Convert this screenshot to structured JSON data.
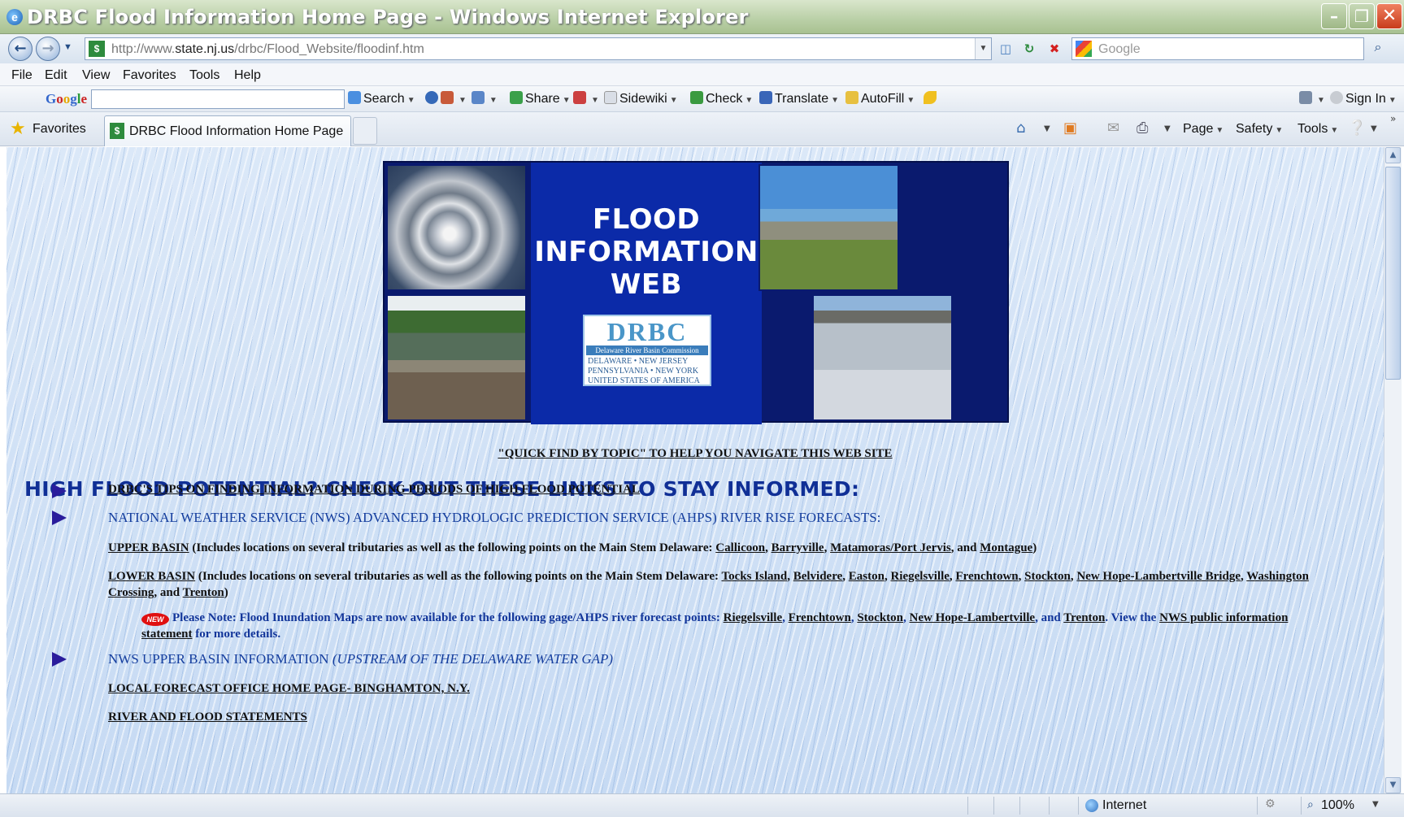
{
  "window": {
    "title": "DRBC Flood Information Home Page - Windows Internet Explorer",
    "controls": {
      "minimize": "–",
      "maximize": "❐",
      "close": "✕"
    }
  },
  "addressbar": {
    "url_prefix": "http://www.",
    "url_domain": "state.nj.us",
    "url_path": "/drbc/Flood_Website/floodinf.htm",
    "search_placeholder": "Google"
  },
  "menu": {
    "items": [
      "File",
      "Edit",
      "View",
      "Favorites",
      "Tools",
      "Help"
    ]
  },
  "google_toolbar": {
    "search": "Search",
    "share": "Share",
    "sidewiki": "Sidewiki",
    "check": "Check",
    "translate": "Translate",
    "autofill": "AutoFill",
    "sign_in": "Sign In"
  },
  "favorites_bar": {
    "favorites_label": "Favorites",
    "tab_title": "DRBC Flood Information Home Page",
    "commands": {
      "page": "Page",
      "safety": "Safety",
      "tools": "Tools"
    }
  },
  "banner": {
    "title_lines": [
      "FLOOD",
      "INFORMATION",
      "WEB"
    ],
    "logo_mark": "DRBC",
    "logo_name": "Delaware River Basin Commission",
    "logo_states": [
      "DELAWARE",
      "NEW JERSEY",
      "PENNSYLVANIA",
      "NEW YORK",
      "UNITED STATES OF AMERICA"
    ]
  },
  "content": {
    "quick_find": "\"QUICK FIND BY TOPIC\" TO HELP YOU NAVIGATE THIS WEB SITE",
    "headline": "HIGH FLOOD POTENTIAL? CHECK-OUT THESE LINKS TO STAY INFORMED:",
    "tips_link": "DRBC'S TIPS ON FINDING INFORMATION DURING PERIODS OF HIGH FLOOD POTENTIAL",
    "ahps_heading": "NATIONAL WEATHER SERVICE (NWS) ADVANCED HYDROLOGIC PREDICTION SERVICE (AHPS) RIVER RISE FORECASTS:",
    "upper": {
      "link": "UPPER BASIN",
      "text": " (Includes locations on several tributaries as well as the following points on the Main Stem Delaware: ",
      "points": [
        "Callicoon",
        "Barryville",
        "Matamoras/Port Jervis",
        "Montague"
      ]
    },
    "lower": {
      "link": "LOWER BASIN",
      "text": " (Includes locations on several tributaries as well as the following points on the Main Stem Delaware: ",
      "points": [
        "Tocks Island",
        "Belvidere",
        "Easton",
        "Riegelsville",
        "Frenchtown",
        "Stockton",
        "New Hope-Lambertville Bridge",
        "Washington Crossing",
        "Trenton"
      ]
    },
    "note": {
      "badge": "NEW",
      "text": "Please Note: Flood Inundation Maps are now available for the following gage/AHPS river forecast points: ",
      "points": [
        "Riegelsville",
        "Frenchtown",
        "Stockton",
        "New Hope-Lambertville",
        "Trenton"
      ],
      "view_text": ". View the ",
      "statement_link": "NWS public information statement",
      "tail": " for more details."
    },
    "upper_basin_info": "NWS UPPER BASIN INFORMATION",
    "upper_basin_info_note": "(UPSTREAM OF THE DELAWARE WATER GAP)",
    "local_forecast": "LOCAL FORECAST OFFICE HOME PAGE- BINGHAMTON, N.Y.",
    "river_statements": "RIVER AND FLOOD STATEMENTS"
  },
  "statusbar": {
    "zone": "Internet",
    "zoom": "100%"
  },
  "colors": {
    "headline": "#102f96",
    "link_blue": "#153e9e",
    "banner_navy": "#0a1a6e"
  }
}
